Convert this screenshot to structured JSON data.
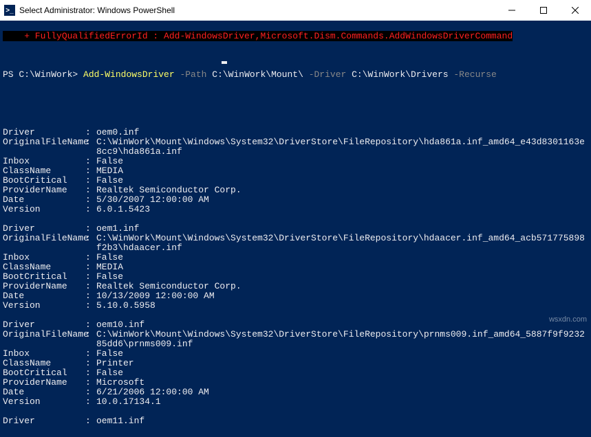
{
  "window": {
    "title": "Select Administrator: Windows PowerShell",
    "icon_text": ">_"
  },
  "error_line": "    + FullyQualifiedErrorId : Add-WindowsDriver,Microsoft.Dism.Commands.AddWindowsDriverCommand",
  "prompt": {
    "path": "PS C:\\WinWork> ",
    "cmd": "Add-WindowsDriver",
    "param1": " -Path",
    "arg1": " C:\\WinWork\\Mount\\",
    "param2": " -Driver",
    "arg2": " C:\\WinWork\\Drivers",
    "param3": " -Recurse"
  },
  "entries": [
    {
      "rows": [
        {
          "label": "Driver",
          "value": "oem0.inf"
        },
        {
          "label": "OriginalFileName",
          "value": "C:\\WinWork\\Mount\\Windows\\System32\\DriverStore\\FileRepository\\hda861a.inf_amd64_e43d8301163e8cc9\\hda861a.inf"
        },
        {
          "label": "Inbox",
          "value": "False"
        },
        {
          "label": "ClassName",
          "value": "MEDIA"
        },
        {
          "label": "BootCritical",
          "value": "False"
        },
        {
          "label": "ProviderName",
          "value": "Realtek Semiconductor Corp."
        },
        {
          "label": "Date",
          "value": "5/30/2007 12:00:00 AM"
        },
        {
          "label": "Version",
          "value": "6.0.1.5423"
        }
      ]
    },
    {
      "rows": [
        {
          "label": "Driver",
          "value": "oem1.inf"
        },
        {
          "label": "OriginalFileName",
          "value": "C:\\WinWork\\Mount\\Windows\\System32\\DriverStore\\FileRepository\\hdaacer.inf_amd64_acb571775898f2b3\\hdaacer.inf"
        },
        {
          "label": "Inbox",
          "value": "False"
        },
        {
          "label": "ClassName",
          "value": "MEDIA"
        },
        {
          "label": "BootCritical",
          "value": "False"
        },
        {
          "label": "ProviderName",
          "value": "Realtek Semiconductor Corp."
        },
        {
          "label": "Date",
          "value": "10/13/2009 12:00:00 AM"
        },
        {
          "label": "Version",
          "value": "5.10.0.5958"
        }
      ]
    },
    {
      "rows": [
        {
          "label": "Driver",
          "value": "oem10.inf"
        },
        {
          "label": "OriginalFileName",
          "value": "C:\\WinWork\\Mount\\Windows\\System32\\DriverStore\\FileRepository\\prnms009.inf_amd64_5887f9f923285dd6\\prnms009.inf"
        },
        {
          "label": "Inbox",
          "value": "False"
        },
        {
          "label": "ClassName",
          "value": "Printer"
        },
        {
          "label": "BootCritical",
          "value": "False"
        },
        {
          "label": "ProviderName",
          "value": "Microsoft"
        },
        {
          "label": "Date",
          "value": "6/21/2006 12:00:00 AM"
        },
        {
          "label": "Version",
          "value": "10.0.17134.1"
        }
      ]
    },
    {
      "rows": [
        {
          "label": "Driver",
          "value": "oem11.inf"
        }
      ]
    }
  ],
  "watermark": "wsxdn.com"
}
